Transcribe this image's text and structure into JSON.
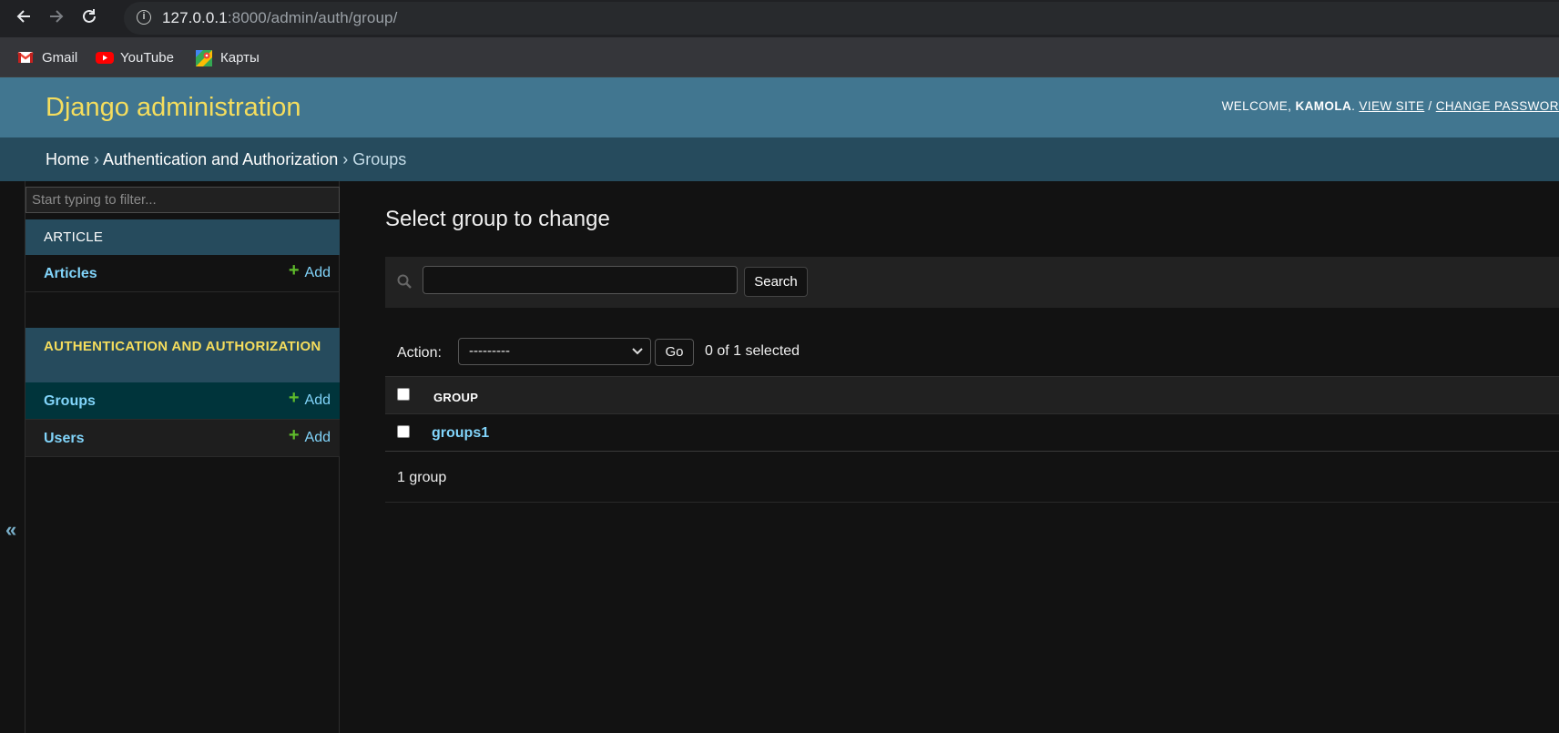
{
  "browser": {
    "url_host": "127.0.0.1",
    "url_path": ":8000/admin/auth/group/",
    "bookmarks": [
      {
        "label": "Gmail",
        "icon": "gmail-icon"
      },
      {
        "label": "YouTube",
        "icon": "youtube-icon"
      },
      {
        "label": "Карты",
        "icon": "maps-icon"
      }
    ]
  },
  "header": {
    "branding": "Django administration",
    "welcome": "WELCOME, ",
    "username": "KAMOLA",
    "sep1": ". ",
    "view_site": "VIEW SITE",
    "sep2": " / ",
    "change_password": "CHANGE PASSWORD"
  },
  "breadcrumbs": {
    "home": "Home",
    "app": "Authentication and Authorization",
    "current": "Groups",
    "separator": " › "
  },
  "sidebar": {
    "filter_placeholder": "Start typing to filter...",
    "collapse_label": "«",
    "apps": [
      {
        "caption": "ARTICLE",
        "models": [
          {
            "name": "Articles",
            "add": "Add"
          }
        ]
      },
      {
        "caption": "AUTHENTICATION AND AUTHORIZATION",
        "models": [
          {
            "name": "Groups",
            "add": "Add"
          },
          {
            "name": "Users",
            "add": "Add"
          }
        ]
      }
    ]
  },
  "content": {
    "title": "Select group to change",
    "search_button": "Search",
    "action_label": "Action:",
    "action_selected": "---------",
    "go_button": "Go",
    "counter": "0 of 1 selected",
    "column_header": "GROUP",
    "rows": [
      "groups1"
    ],
    "paginator": "1 group"
  },
  "colors": {
    "header_bg": "#417690",
    "breadcrumb_bg": "#264b5d",
    "branding": "#f5dd5d",
    "link": "#81d4fa",
    "add_plus": "#5fbc2b",
    "current_model_bg": "#00343b"
  }
}
